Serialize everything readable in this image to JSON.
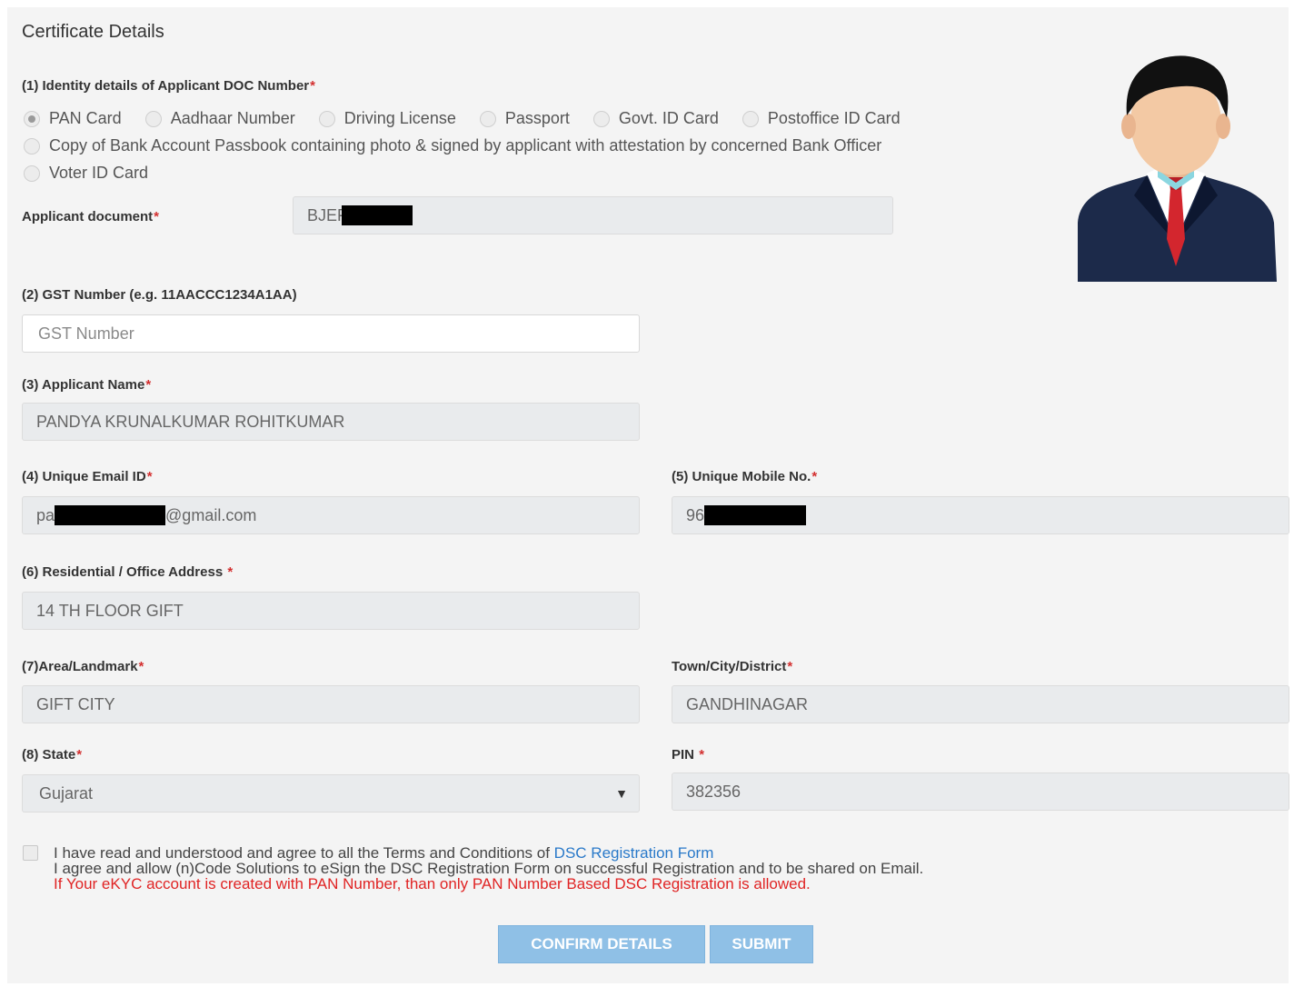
{
  "section_title": "Certificate Details",
  "identity": {
    "label": "(1) Identity details of Applicant DOC Number",
    "required": "*",
    "options": [
      {
        "label": "PAN Card",
        "checked": true
      },
      {
        "label": "Aadhaar Number",
        "checked": false
      },
      {
        "label": "Driving License",
        "checked": false
      },
      {
        "label": "Passport",
        "checked": false
      },
      {
        "label": "Govt. ID Card",
        "checked": false
      },
      {
        "label": "Postoffice ID Card",
        "checked": false
      },
      {
        "label": "Copy of Bank Account Passbook containing photo & signed by applicant with attestation by concerned Bank Officer",
        "checked": false
      },
      {
        "label": "Voter ID Card",
        "checked": false
      }
    ]
  },
  "applicant_document": {
    "label": "Applicant document",
    "required": "*",
    "value": "BJEF"
  },
  "gst": {
    "label": "(2) GST Number (e.g. 11AACCC1234A1AA)",
    "placeholder": "GST Number",
    "value": ""
  },
  "applicant_name": {
    "label": "(3) Applicant Name",
    "required": "*",
    "value": "PANDYA KRUNALKUMAR ROHITKUMAR"
  },
  "email": {
    "label": "(4) Unique Email ID",
    "required": "*",
    "value_prefix": "pa",
    "value_suffix": "@gmail.com"
  },
  "mobile": {
    "label": "(5) Unique Mobile No.",
    "required": "*",
    "value_prefix": "96"
  },
  "address": {
    "label": "(6) Residential / Office Address",
    "required": "*",
    "value": "14 TH FLOOR GIFT"
  },
  "area": {
    "label": "(7)Area/Landmark",
    "required": "*",
    "value": "GIFT CITY"
  },
  "town": {
    "label": "Town/City/District",
    "required": "*",
    "value": "GANDHINAGAR"
  },
  "state": {
    "label": "(8) State",
    "required": "*",
    "value": "Gujarat",
    "arrow": "▼"
  },
  "pin": {
    "label": "PIN",
    "required": "*",
    "value": "382356"
  },
  "terms": {
    "line1_text": "I have read and understood and agree to all the Terms and Conditions of ",
    "line1_link": "DSC Registration Form",
    "line2": "I agree and allow (n)Code Solutions to eSign the DSC Registration Form on successful Registration and to be shared on Email.",
    "warning": "If Your eKYC account is created with PAN Number, than only PAN Number Based DSC Registration is allowed."
  },
  "buttons": {
    "confirm": "CONFIRM DETAILS",
    "submit": "SUBMIT"
  },
  "icons": {
    "avatar": "businessman-avatar-icon",
    "select_arrow": "chevron-down-icon"
  },
  "colors": {
    "required": "#d32f2f",
    "link": "#2979c9",
    "warning": "#e02424",
    "button": "#8fc0e6"
  }
}
